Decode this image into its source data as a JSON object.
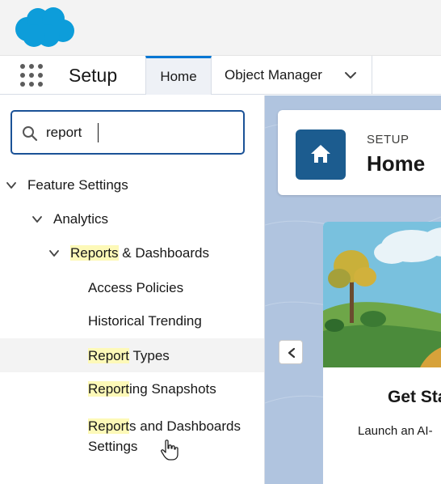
{
  "colors": {
    "brand_cloud": "#0d9dda",
    "tab_active_border": "#0176d3",
    "search_border": "#1b5297",
    "highlight": "#fdf9b8",
    "home_tile": "#1c5c8f",
    "main_background": "#b0c4df"
  },
  "header": {
    "logo_icon": "salesforce-cloud-icon"
  },
  "nav": {
    "app_launcher_icon": "waffle-grid-icon",
    "app_name": "Setup",
    "tabs": [
      {
        "label": "Home",
        "active": true
      },
      {
        "label": "Object Manager",
        "active": false,
        "icon": "chevron-down-icon"
      }
    ]
  },
  "sidebar": {
    "search": {
      "value": "report",
      "icon": "search-icon"
    },
    "tree": {
      "feature_settings": "Feature Settings",
      "analytics": "Analytics",
      "reports_dashboards": {
        "highlight": "Reports",
        "rest": " & Dashboards"
      },
      "access_policies": "Access Policies",
      "historical_trending": "Historical Trending",
      "report_types": {
        "highlight": "Report",
        "rest": " Types"
      },
      "reporting_snapshots": {
        "highlight": "Report",
        "rest": "ing Snapshots"
      },
      "reports_and_dashboards_settings": {
        "highlight": "Report",
        "rest1": "s and Dashboards",
        "rest2": "Settings"
      }
    }
  },
  "main": {
    "header": {
      "eyebrow": "SETUP",
      "title": "Home",
      "icon": "home-icon"
    },
    "collapse_icon": "chevron-left-icon",
    "promo": {
      "title": "Get Sta",
      "text": "Launch an AI-"
    }
  }
}
